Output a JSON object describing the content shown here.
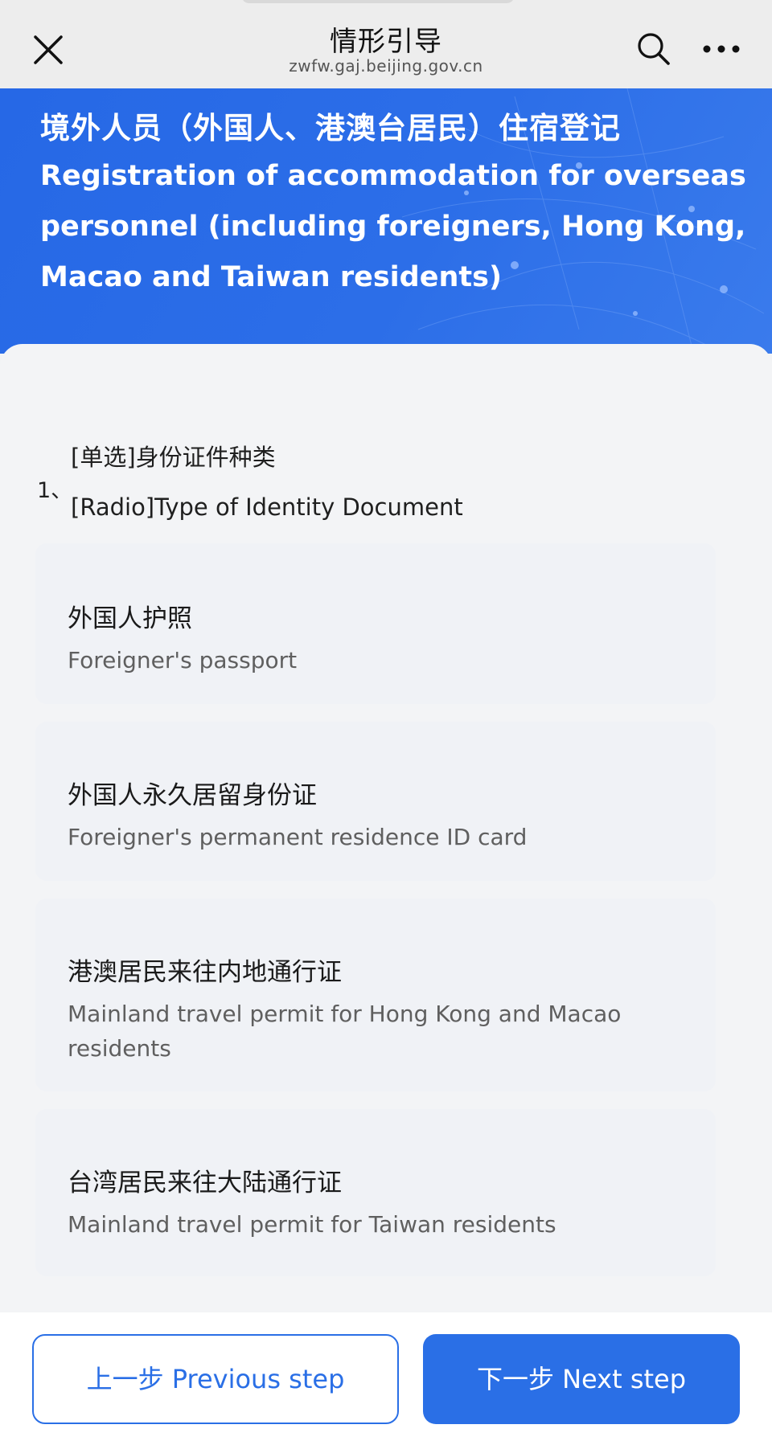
{
  "topbar": {
    "title": "情形引导",
    "domain": "zwfw.gaj.beijing.gov.cn"
  },
  "hero": {
    "title_zh": "境外人员（外国人、港澳台居民）住宿登记",
    "title_en": "Registration of accommodation for overseas personnel (including foreigners, Hong Kong, Macao and Taiwan residents)"
  },
  "question": {
    "number": "1、",
    "label_zh": "[单选]身份证件种类",
    "label_en": "[Radio]Type of Identity Document",
    "options": [
      {
        "zh": "外国人护照",
        "en": "Foreigner's passport"
      },
      {
        "zh": "外国人永久居留身份证",
        "en": "Foreigner's permanent residence ID card"
      },
      {
        "zh": "港澳居民来往内地通行证",
        "en": "Mainland travel permit for Hong Kong and Macao residents"
      },
      {
        "zh": "台湾居民来往大陆通行证",
        "en": "Mainland travel permit for Taiwan residents"
      }
    ]
  },
  "footer": {
    "prev_label": "上一步 Previous step",
    "next_label": "下一步 Next step"
  },
  "colors": {
    "accent": "#2a6fe6",
    "hero_blue": "#2c6ee8",
    "page_bg": "#f3f4f6"
  }
}
